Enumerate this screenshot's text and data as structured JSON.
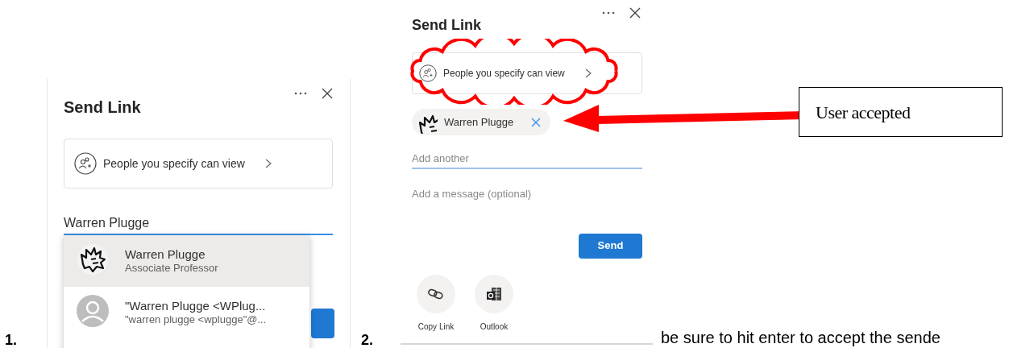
{
  "step_labels": [
    "1.",
    "2."
  ],
  "panel_1": {
    "title": "Send Link",
    "permission": "People you specify can view",
    "recipient_field": {
      "value": "Warren Plugge"
    },
    "suggestions": [
      {
        "name": "Warren Plugge",
        "subtitle": "Associate Professor",
        "avatar": {
          "kind": "mascot"
        },
        "selected": true
      },
      {
        "name": "\"Warren Plugge <WPlug...",
        "subtitle": "\"warren plugge <wplugge\"@...",
        "avatar": {
          "kind": "silhouette"
        },
        "selected": false
      }
    ]
  },
  "panel_2": {
    "title": "Send Link",
    "permission": "People you specify can view",
    "recipient_chip": {
      "name": "Warren Plugge",
      "avatar": {
        "kind": "mascot"
      }
    },
    "add_field": {
      "placeholder": "Add another"
    },
    "message_field": {
      "placeholder": "Add a message (optional)"
    },
    "send_button": "Send",
    "share_options": [
      {
        "label": "Copy Link",
        "kind": "link"
      },
      {
        "label": "Outlook",
        "kind": "outlook"
      }
    ]
  },
  "callout": {
    "text": "User accepted"
  },
  "caption": "be sure to hit enter to accept the sende"
}
